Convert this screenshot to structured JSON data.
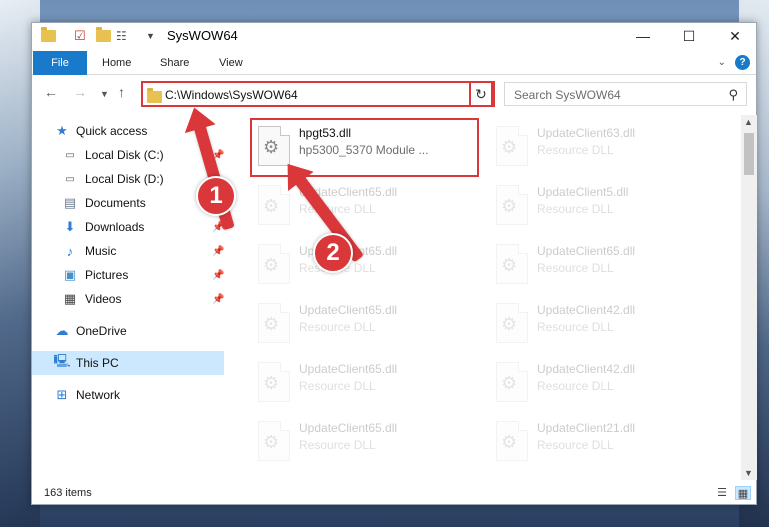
{
  "window": {
    "title": "SysWOW64"
  },
  "window_controls": {
    "minimize": "—",
    "maximize": "☐",
    "close": "✕"
  },
  "ribbon": {
    "file_tab": "File",
    "tabs": [
      "Home",
      "Share",
      "View"
    ],
    "help": "?"
  },
  "address": {
    "path": "C:\\Windows\\SysWOW64"
  },
  "search": {
    "placeholder": "Search SysWOW64"
  },
  "sidebar": {
    "items": [
      {
        "label": "Quick access",
        "icon": "star-icon"
      },
      {
        "label": "Local Disk (C:)",
        "icon": "drive-icon"
      },
      {
        "label": "Local Disk (D:)",
        "icon": "drive-icon"
      },
      {
        "label": "Documents",
        "icon": "documents-icon"
      },
      {
        "label": "Downloads",
        "icon": "download-icon"
      },
      {
        "label": "Music",
        "icon": "music-icon"
      },
      {
        "label": "Pictures",
        "icon": "pictures-icon"
      },
      {
        "label": "Videos",
        "icon": "videos-icon"
      },
      {
        "label": "OneDrive",
        "icon": "cloud-icon"
      },
      {
        "label": "This PC",
        "icon": "computer-icon"
      },
      {
        "label": "Network",
        "icon": "network-icon"
      }
    ]
  },
  "files": [
    {
      "name": "hpgt53.dll",
      "type": "hp5300_5370 Module ..."
    },
    {
      "name": "UpdateClient63.dll",
      "type": "Resource DLL"
    },
    {
      "name": "UpdateClient65.dll",
      "type": "Resource DLL"
    },
    {
      "name": "UpdateClient5.dll",
      "type": "Resource DLL"
    },
    {
      "name": "UpdateClient65.dll",
      "type": "Resource DLL"
    },
    {
      "name": "UpdateClient65.dll",
      "type": "Resource DLL"
    },
    {
      "name": "UpdateClient65.dll",
      "type": "Resource DLL"
    },
    {
      "name": "UpdateClient42.dll",
      "type": "Resource DLL"
    },
    {
      "name": "UpdateClient65.dll",
      "type": "Resource DLL"
    },
    {
      "name": "UpdateClient42.dll",
      "type": "Resource DLL"
    },
    {
      "name": "UpdateClient65.dll",
      "type": "Resource DLL"
    },
    {
      "name": "UpdateClient21.dll",
      "type": "Resource DLL"
    }
  ],
  "status": {
    "count": "163 items"
  },
  "annotations": {
    "step1": "1",
    "step2": "2"
  },
  "colors": {
    "accent": "#1979ca",
    "highlight": "#d9373a",
    "selection": "#cce8ff"
  }
}
